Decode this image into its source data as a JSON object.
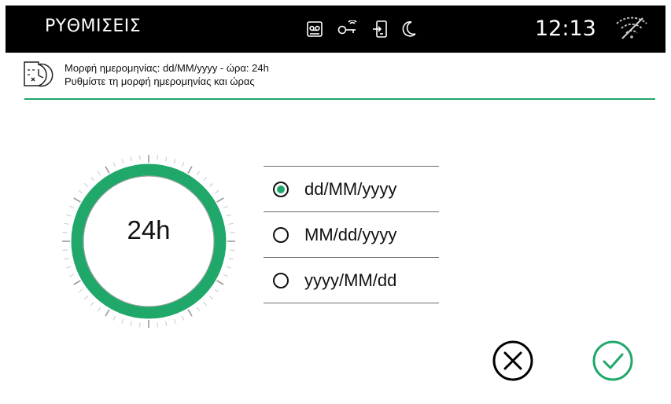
{
  "header": {
    "title": "ΡΥΘΜΙΣΕΙΣ",
    "clock": "12:13",
    "status_icons": [
      "voicemail-icon",
      "key-icon",
      "door-phone-icon",
      "moon-icon"
    ],
    "wifi_icon": "wifi-off-icon"
  },
  "info": {
    "icon": "calendar-clock-icon",
    "line1": "Μορφή ημερομηνίας: dd/MM/yyyy - ώρα: 24h",
    "line2": "Ρυθμίστε τη μορφή ημερομηνίας και ώρας"
  },
  "time_format": {
    "value": "24h",
    "accent_color": "#1fa86a"
  },
  "date_formats": {
    "options": [
      {
        "label": "dd/MM/yyyy",
        "selected": true
      },
      {
        "label": "MM/dd/yyyy",
        "selected": false
      },
      {
        "label": "yyyy/MM/dd",
        "selected": false
      }
    ]
  },
  "actions": {
    "cancel_icon": "close-circle-icon",
    "confirm_icon": "check-circle-icon",
    "confirm_color": "#1fa86a"
  }
}
